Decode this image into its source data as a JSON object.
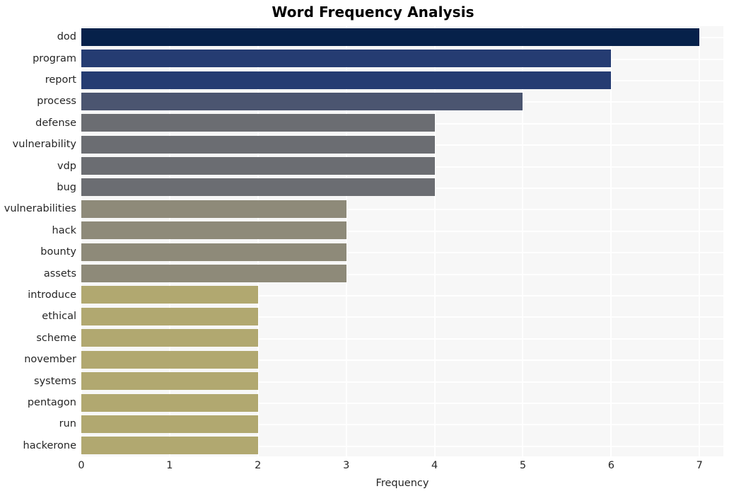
{
  "chart_data": {
    "type": "bar",
    "orientation": "horizontal",
    "title": "Word Frequency Analysis",
    "xlabel": "Frequency",
    "ylabel": "",
    "xlim": [
      0,
      7.27
    ],
    "xticks": [
      0,
      1,
      2,
      3,
      4,
      5,
      6,
      7
    ],
    "xtick_labels": [
      "0",
      "1",
      "2",
      "3",
      "4",
      "5",
      "6",
      "7"
    ],
    "grid": true,
    "grid_color": "#ffffff",
    "plot_background": "#f7f7f7",
    "figure_background": "#ffffff",
    "legend": null,
    "categories": [
      "dod",
      "program",
      "report",
      "process",
      "defense",
      "vulnerability",
      "vdp",
      "bug",
      "vulnerabilities",
      "hack",
      "bounty",
      "assets",
      "introduce",
      "ethical",
      "scheme",
      "november",
      "systems",
      "pentagon",
      "run",
      "hackerone"
    ],
    "values": [
      7,
      6,
      6,
      5,
      4,
      4,
      4,
      4,
      3,
      3,
      3,
      3,
      2,
      2,
      2,
      2,
      2,
      2,
      2,
      2
    ],
    "bar_colors": [
      "#06214a",
      "#253c72",
      "#253c72",
      "#4b5570",
      "#6b6d72",
      "#6b6d72",
      "#6b6d72",
      "#6b6d72",
      "#8e8a79",
      "#8e8a79",
      "#8e8a79",
      "#8e8a79",
      "#b1a870",
      "#b1a870",
      "#b1a870",
      "#b1a870",
      "#b1a870",
      "#b1a870",
      "#b1a870",
      "#b1a870"
    ],
    "bars": [
      {
        "label": "dod",
        "value": 7,
        "color": "#06214a"
      },
      {
        "label": "program",
        "value": 6,
        "color": "#253c72"
      },
      {
        "label": "report",
        "value": 6,
        "color": "#253c72"
      },
      {
        "label": "process",
        "value": 5,
        "color": "#4b5570"
      },
      {
        "label": "defense",
        "value": 4,
        "color": "#6b6d72"
      },
      {
        "label": "vulnerability",
        "value": 4,
        "color": "#6b6d72"
      },
      {
        "label": "vdp",
        "value": 4,
        "color": "#6b6d72"
      },
      {
        "label": "bug",
        "value": 4,
        "color": "#6b6d72"
      },
      {
        "label": "vulnerabilities",
        "value": 3,
        "color": "#8e8a79"
      },
      {
        "label": "hack",
        "value": 3,
        "color": "#8e8a79"
      },
      {
        "label": "bounty",
        "value": 3,
        "color": "#8e8a79"
      },
      {
        "label": "assets",
        "value": 3,
        "color": "#8e8a79"
      },
      {
        "label": "introduce",
        "value": 2,
        "color": "#b1a870"
      },
      {
        "label": "ethical",
        "value": 2,
        "color": "#b1a870"
      },
      {
        "label": "scheme",
        "value": 2,
        "color": "#b1a870"
      },
      {
        "label": "november",
        "value": 2,
        "color": "#b1a870"
      },
      {
        "label": "systems",
        "value": 2,
        "color": "#b1a870"
      },
      {
        "label": "pentagon",
        "value": 2,
        "color": "#b1a870"
      },
      {
        "label": "run",
        "value": 2,
        "color": "#b1a870"
      },
      {
        "label": "hackerone",
        "value": 2,
        "color": "#b1a870"
      }
    ]
  }
}
